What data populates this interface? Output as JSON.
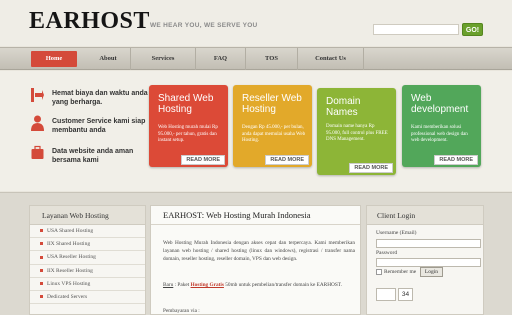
{
  "header": {
    "logo": "EARHOST",
    "tagline": "WE HEAR YOU, WE SERVE YOU",
    "search_placeholder": "",
    "search_button": "GO!"
  },
  "nav": {
    "items": [
      {
        "label": "Home",
        "active": true
      },
      {
        "label": "About",
        "active": false
      },
      {
        "label": "Services",
        "active": false
      },
      {
        "label": "FAQ",
        "active": false
      },
      {
        "label": "TOS",
        "active": false
      },
      {
        "label": "Contact Us",
        "active": false
      }
    ]
  },
  "features": [
    {
      "icon": "trend-arrow-icon",
      "text": "Hemat biaya dan waktu anda yang berharga."
    },
    {
      "icon": "person-icon",
      "text": "Customer Service kami siap membantu anda"
    },
    {
      "icon": "briefcase-icon",
      "text": "Data website anda aman bersama kami"
    }
  ],
  "cards": [
    {
      "title": "Shared Web Hosting",
      "desc": "Web Hosting murah mulai Rp 95.000,- per tahun, gratis dan instant setup.",
      "more": "READ MORE",
      "color": "#dc4a37"
    },
    {
      "title": "Reseller Web Hosting",
      "desc": "Dengan Rp 45.000,- per bulan, anda dapat memulai usaha Web Hosting.",
      "more": "READ MORE",
      "color": "#e2a92a"
    },
    {
      "title": "Domain Names",
      "desc": "Domain name hanya Rp 95.000, full control plus FREE DNS Management.",
      "more": "READ MORE",
      "color": "#8db537"
    },
    {
      "title": "Web development",
      "desc": "Kami memberikan solusi professional web design dan web development.",
      "more": "READ MORE",
      "color": "#52a75a"
    }
  ],
  "sidebar": {
    "title": "Layanan Web Hosting",
    "items": [
      "USA Shared Hosting",
      "IIX Shared Hosting",
      "USA Reseller Hosting",
      "IIX Reseller Hosting",
      "Linux VPS Hosting",
      "Dedicated Servers"
    ]
  },
  "content": {
    "title": "EARHOST: Web Hosting Murah Indonesia",
    "para1": "Web Hosting Murah Indonesia dengan akses cepat dan terpercaya. Kami memberikan layanan web hosting / shared hosting (linux dan windows), registrasi / transfer nama domain, reseller hosting, reseller domain, VPS dan web design.",
    "para2_label": "Baru",
    "para2_pre": ": Paket",
    "para2_highlight": "Hosting Gratis",
    "para2_post": "50mb untuk pembelian/transfer domain ke EARHOST.",
    "para3": "Pembayaran via :"
  },
  "login": {
    "title": "Client Login",
    "username_label": "Username (Email)",
    "password_label": "Password",
    "remember_label": "Remember me",
    "login_button": "Login",
    "captcha_value": "34"
  }
}
